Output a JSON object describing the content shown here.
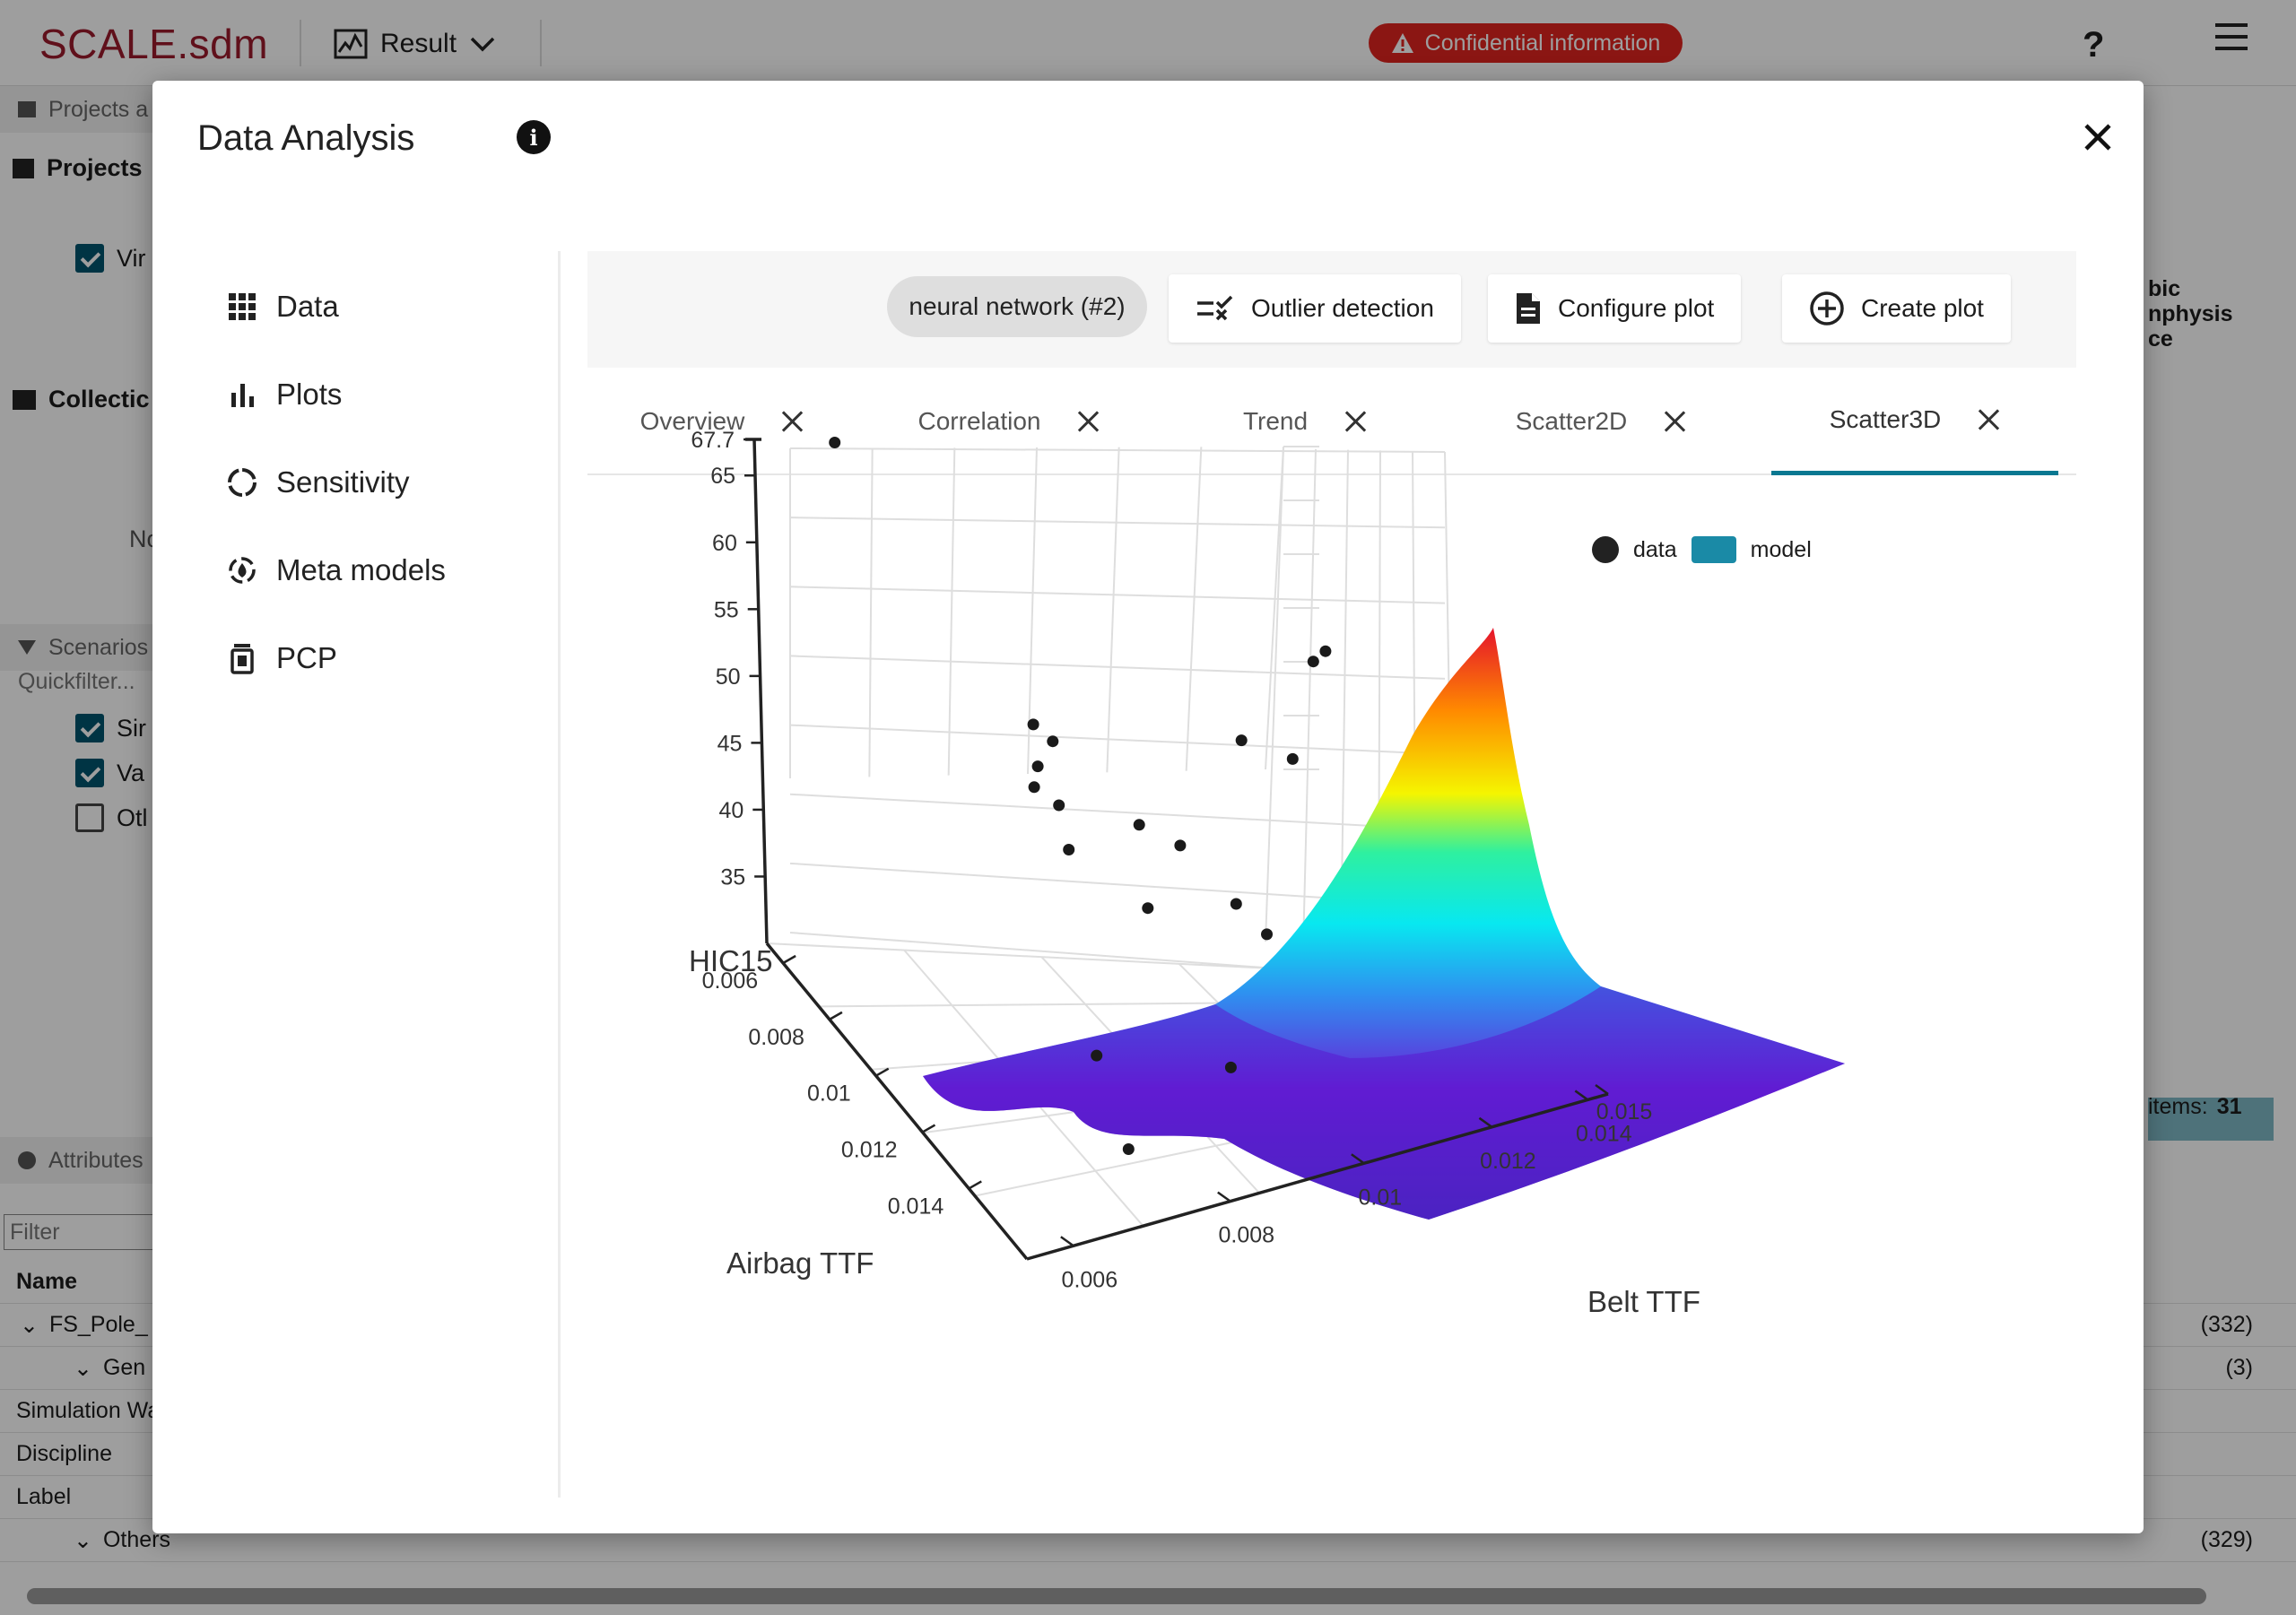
{
  "app": {
    "logo": "SCALE.sdm",
    "result_label": "Result",
    "confidential_label": "Confidential information",
    "help_label": "?"
  },
  "left_panel": {
    "projects_header": "Projects a",
    "projects_label": "Projects",
    "vir_label": "Vir",
    "collections_label": "Collectic",
    "no_label": "No",
    "scenarios_header": "Scenarios",
    "quickfilter": "Quickfilter...",
    "scenario_items": [
      {
        "label": "Sir",
        "checked": true
      },
      {
        "label": "Va",
        "checked": true
      },
      {
        "label": "Otl",
        "checked": false
      }
    ],
    "attributes_header": "Attributes",
    "filter_placeholder": "Filter"
  },
  "right_panel": {
    "line1": "bic",
    "line2": "nphysis",
    "line3": "ce",
    "items_label": "items:",
    "items_count": "31"
  },
  "bottom_table": {
    "name_header": "Name",
    "rows": [
      {
        "label": "FS_Pole_",
        "count": "(332)",
        "expander": true,
        "indent": 0
      },
      {
        "label": "Gen",
        "count": "(3)",
        "expander": true,
        "indent": 1
      },
      {
        "label": "Simulation Wa",
        "count": "",
        "expander": false,
        "indent": 0
      },
      {
        "label": "Discipline",
        "count": "",
        "expander": false,
        "indent": 0
      },
      {
        "label": "Label",
        "count": "",
        "expander": false,
        "indent": 0
      },
      {
        "label": "Others",
        "count": "(329)",
        "expander": true,
        "indent": 1
      }
    ]
  },
  "modal": {
    "title": "Data Analysis",
    "nav": [
      {
        "label": "Data",
        "icon": "grid-icon"
      },
      {
        "label": "Plots",
        "icon": "bar-chart-icon"
      },
      {
        "label": "Sensitivity",
        "icon": "sensitivity-icon"
      },
      {
        "label": "Meta models",
        "icon": "meta-model-icon"
      },
      {
        "label": "PCP",
        "icon": "pcp-icon"
      }
    ],
    "toolbar": {
      "model_chip": "neural network (#2)",
      "outlier_label": "Outlier detection",
      "configure_label": "Configure plot",
      "create_label": "Create plot"
    },
    "tabs": [
      {
        "label": "Overview",
        "active": false
      },
      {
        "label": "Correlation",
        "active": false
      },
      {
        "label": "Trend",
        "active": false
      },
      {
        "label": "Scatter2D",
        "active": false
      },
      {
        "label": "Scatter3D",
        "active": true
      }
    ],
    "legend": {
      "data_label": "data",
      "model_label": "model",
      "data_color": "#222222",
      "model_color": "#1a8aa6"
    }
  },
  "chart_data": {
    "type": "scatter3d",
    "xlabel": "Airbag TTF",
    "ylabel": "Belt TTF",
    "zlabel": "HIC15",
    "x_ticks": [
      "0.006",
      "0.008",
      "0.01",
      "0.012",
      "0.014"
    ],
    "y_ticks": [
      "0.006",
      "0.008",
      "0.01",
      "0.012",
      "0.014",
      "0.015"
    ],
    "z_ticks": [
      "35",
      "40",
      "45",
      "50",
      "55",
      "60",
      "65",
      "67.7"
    ],
    "zlim": [
      30,
      67.7
    ],
    "surface_colorscale": "rainbow (purple low → red high)",
    "series": [
      {
        "name": "data",
        "points": [
          {
            "airbag": 0.0066,
            "belt": 0.0062,
            "hic": 67.7
          },
          {
            "airbag": 0.0072,
            "belt": 0.0095,
            "hic": 44.5
          },
          {
            "airbag": 0.0075,
            "belt": 0.0097,
            "hic": 43.8
          },
          {
            "airbag": 0.0077,
            "belt": 0.0093,
            "hic": 42.9
          },
          {
            "airbag": 0.0085,
            "belt": 0.0088,
            "hic": 44.0
          },
          {
            "airbag": 0.0088,
            "belt": 0.0091,
            "hic": 43.1
          },
          {
            "airbag": 0.0093,
            "belt": 0.009,
            "hic": 41.2
          },
          {
            "airbag": 0.009,
            "belt": 0.0105,
            "hic": 40.6
          },
          {
            "airbag": 0.0095,
            "belt": 0.011,
            "hic": 39.8
          },
          {
            "airbag": 0.0098,
            "belt": 0.0102,
            "hic": 36.8
          },
          {
            "airbag": 0.0105,
            "belt": 0.0115,
            "hic": 37.5
          },
          {
            "airbag": 0.011,
            "belt": 0.0118,
            "hic": 36.2
          },
          {
            "airbag": 0.008,
            "belt": 0.013,
            "hic": 41.5
          },
          {
            "airbag": 0.0083,
            "belt": 0.0138,
            "hic": 40.0
          },
          {
            "airbag": 0.0078,
            "belt": 0.0145,
            "hic": 45.2
          },
          {
            "airbag": 0.0073,
            "belt": 0.015,
            "hic": 44.1
          },
          {
            "airbag": 0.012,
            "belt": 0.008,
            "hic": 34.0
          },
          {
            "airbag": 0.013,
            "belt": 0.01,
            "hic": 33.5
          },
          {
            "airbag": 0.014,
            "belt": 0.0075,
            "hic": 32.8
          }
        ]
      },
      {
        "name": "model",
        "type": "surface"
      }
    ]
  }
}
